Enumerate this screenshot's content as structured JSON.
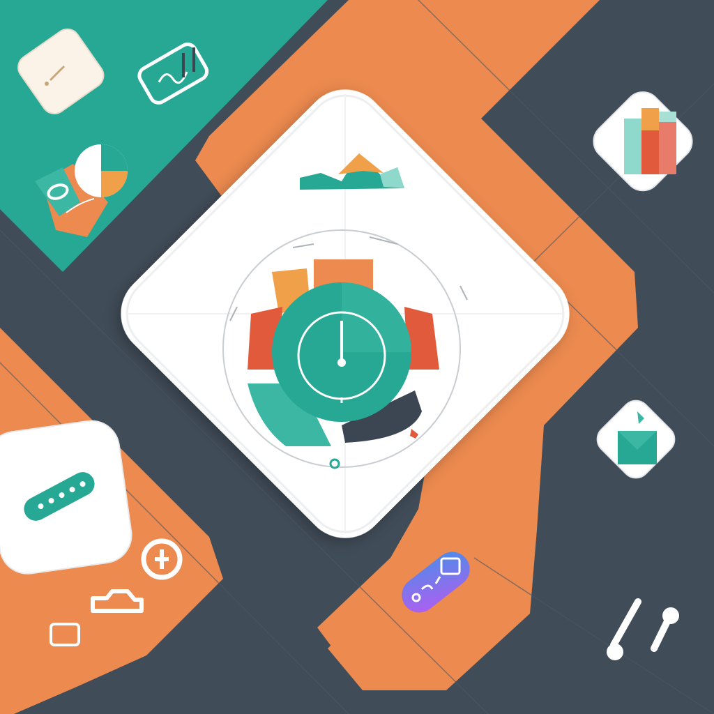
{
  "palette": {
    "background": "#404c58",
    "teal": "#27a894",
    "teal_light": "#3bb7a3",
    "orange": "#ec8a4f",
    "orange_dark": "#e0763c",
    "red": "#e25a3c",
    "white": "#ffffff",
    "gray_line": "#c9cdd1",
    "dark_slate": "#3b4652",
    "violet": "#8a5cf0",
    "blue": "#4a8de8"
  },
  "icons": {
    "central_gauge": "gauge-clock-icon",
    "mountain": "mountain-icon",
    "bar_chart": "bar-chart-icon",
    "envelope": "envelope-icon",
    "card": "card-icon",
    "ticket": "ticket-icon",
    "pie": "pie-chart-icon",
    "progress_pill": "progress-pill-icon",
    "gradient_pill": "gradient-pill-icon",
    "tools": "tools-icon",
    "badge": "badge-icon",
    "car": "car-icon",
    "window": "window-icon"
  }
}
